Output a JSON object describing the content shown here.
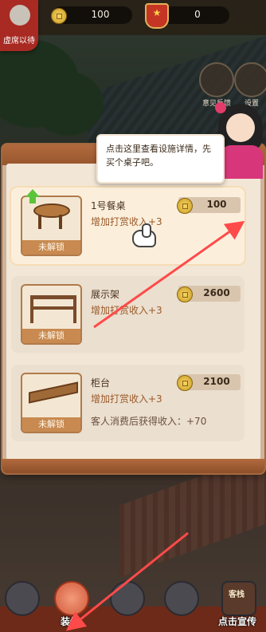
{
  "hud": {
    "corner_badge_label": "虚席以待",
    "coins": "100",
    "reputation": "0",
    "feedback_label": "意见反馈",
    "settings_label": "设置"
  },
  "tutorial": {
    "bubble_text": "点击这里查看设施详情，先买个桌子吧。"
  },
  "facilities": [
    {
      "name": "1号餐桌",
      "bonus": "增加打赏收入+3",
      "price": "100",
      "status": "未解锁",
      "extra": ""
    },
    {
      "name": "展示架",
      "bonus": "增加打赏收入+3",
      "price": "2600",
      "status": "未解锁",
      "extra": ""
    },
    {
      "name": "柜台",
      "bonus": "增加打赏收入+3",
      "price": "2100",
      "status": "未解锁",
      "extra": "客人消费后获得收入：+70"
    }
  ],
  "bottom_nav": {
    "build_label": "装修",
    "promote_label": "点击宣传",
    "guest_sign": "客栈"
  },
  "colors": {
    "arrow": "#ff4a4a",
    "panel_frame": "#a3683f",
    "price_text": "#3a2a1a",
    "bonus_text": "#9a5a2a",
    "unlock_tag": "#c88a50"
  }
}
